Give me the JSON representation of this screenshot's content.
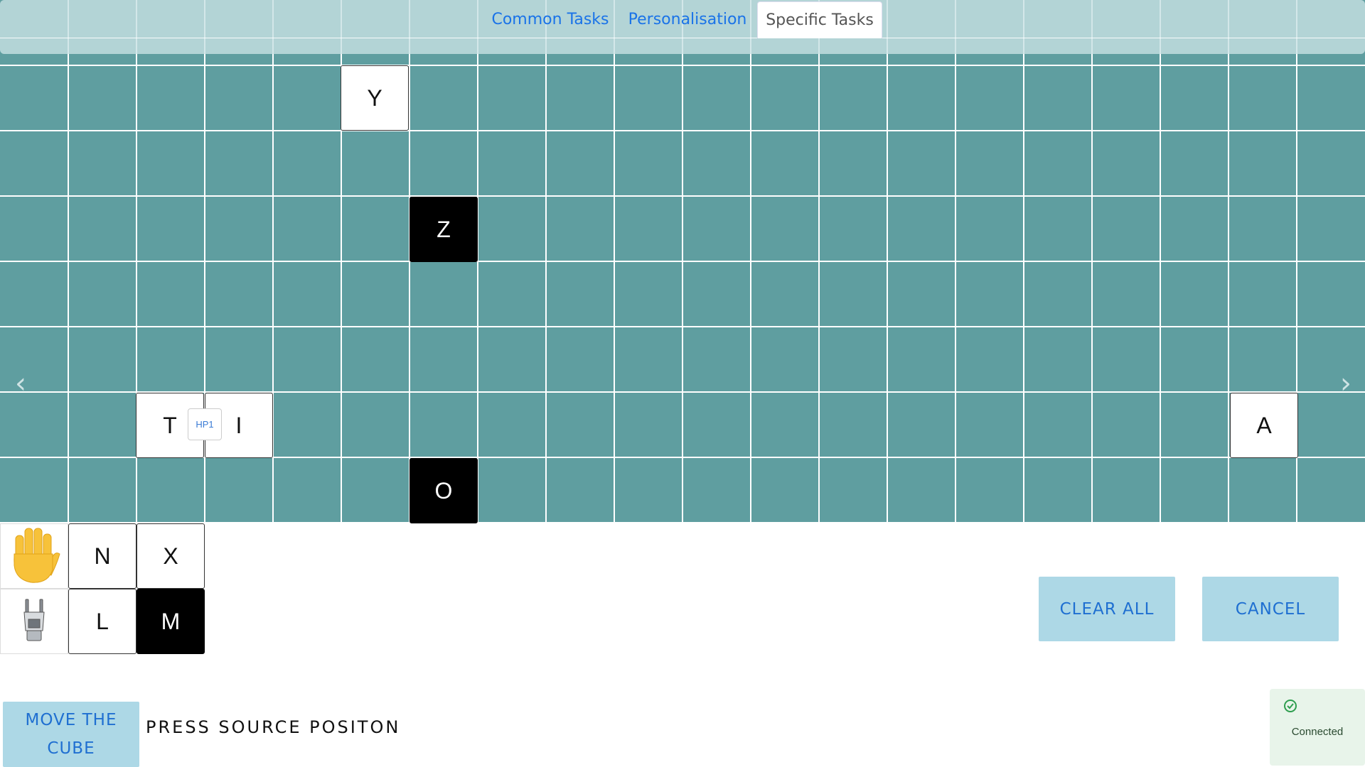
{
  "tabs": [
    {
      "label": "Common Tasks",
      "active": false
    },
    {
      "label": "Personalisation",
      "active": false
    },
    {
      "label": "Specific Tasks",
      "active": true
    }
  ],
  "board": {
    "columns": 20,
    "rows": 8,
    "color": "#5f9ea0",
    "cubes": [
      {
        "label": "Y",
        "color": "white",
        "col": 5,
        "row": 1
      },
      {
        "label": "Z",
        "color": "black",
        "col": 6,
        "row": 3
      },
      {
        "label": "T",
        "color": "white",
        "col": 2,
        "row": 6
      },
      {
        "label": "I",
        "color": "white",
        "col": 3,
        "row": 6
      },
      {
        "label": "A",
        "color": "white",
        "col": 18,
        "row": 6
      },
      {
        "label": "O",
        "color": "black",
        "col": 6,
        "row": 7
      }
    ],
    "hp_badge": "HP1"
  },
  "palette": {
    "row1_icon": "hand-icon",
    "row2_icon": "robot-gripper-icon",
    "cubes": [
      {
        "label": "N",
        "color": "white"
      },
      {
        "label": "X",
        "color": "white"
      },
      {
        "label": "L",
        "color": "white"
      },
      {
        "label": "M",
        "color": "black"
      }
    ]
  },
  "buttons": {
    "clear_all": "CLEAR ALL",
    "cancel": "CANCEL",
    "move_cube": "MOVE THE CUBE"
  },
  "prompt": "PRESS SOURCE POSITON",
  "status": {
    "text": "Connected",
    "icon": "check-circle-icon",
    "color": "#2e9e4f"
  },
  "nav": {
    "prev": "‹",
    "next": "›"
  }
}
